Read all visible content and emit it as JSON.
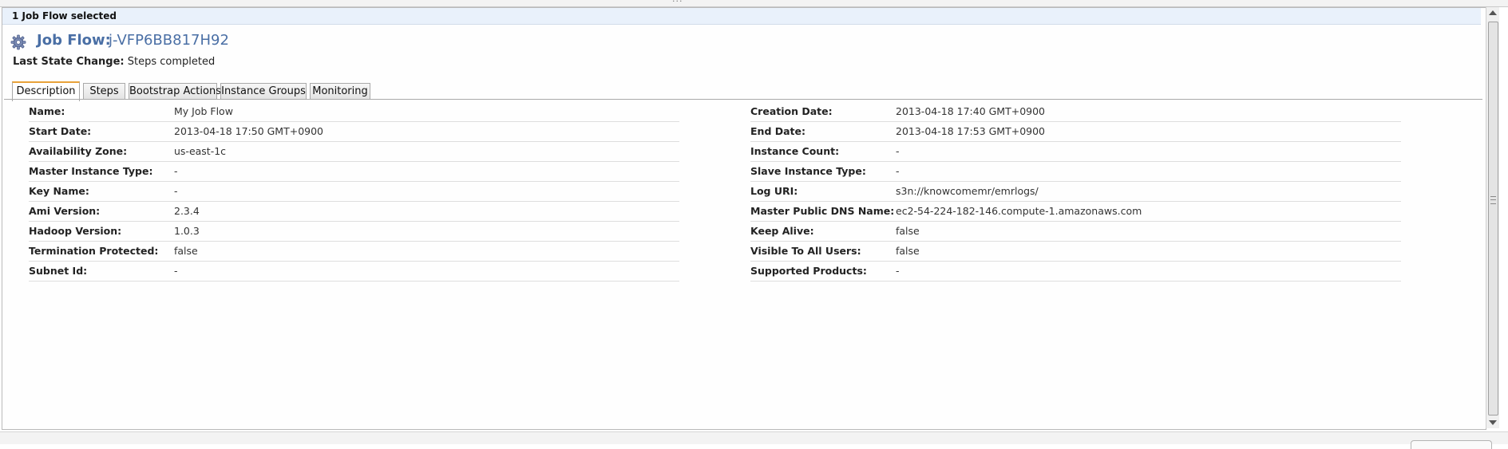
{
  "selection_bar": {
    "text": "1 Job Flow selected"
  },
  "header": {
    "icon": "gear-icon",
    "title_label": "Job Flow:",
    "title_id": "j-VFP6BB817H92",
    "state_label": "Last State Change:",
    "state_value": "Steps completed"
  },
  "tabs": [
    {
      "label": "Description",
      "active": true
    },
    {
      "label": "Steps",
      "active": false
    },
    {
      "label": "Bootstrap Actions",
      "active": false
    },
    {
      "label": "Instance Groups",
      "active": false
    },
    {
      "label": "Monitoring",
      "active": false
    }
  ],
  "details_left": [
    {
      "key": "Name:",
      "value": "My Job Flow"
    },
    {
      "key": "Start Date:",
      "value": "2013-04-18 17:50 GMT+0900"
    },
    {
      "key": "Availability Zone:",
      "value": "us-east-1c"
    },
    {
      "key": "Master Instance Type:",
      "value": "-"
    },
    {
      "key": "Key Name:",
      "value": "-"
    },
    {
      "key": "Ami Version:",
      "value": "2.3.4"
    },
    {
      "key": "Hadoop Version:",
      "value": "1.0.3"
    },
    {
      "key": "Termination Protected:",
      "value": "false"
    },
    {
      "key": "Subnet Id:",
      "value": "-"
    }
  ],
  "details_right": [
    {
      "key": "Creation Date:",
      "value": "2013-04-18 17:40 GMT+0900"
    },
    {
      "key": "End Date:",
      "value": "2013-04-18 17:53 GMT+0900"
    },
    {
      "key": "Instance Count:",
      "value": "-"
    },
    {
      "key": "Slave Instance Type:",
      "value": "-"
    },
    {
      "key": "Log URI:",
      "value": "s3n://knowcomemr/emrlogs/"
    },
    {
      "key": "Master Public DNS Name:",
      "value": "ec2-54-224-182-146.compute-1.amazonaws.com"
    },
    {
      "key": "Keep Alive:",
      "value": "false"
    },
    {
      "key": "Visible To All Users:",
      "value": "false"
    },
    {
      "key": "Supported Products:",
      "value": "-"
    }
  ],
  "colors": {
    "title": "#4a6fa5",
    "selection_bar": "#e9f1fb",
    "active_tab_accent": "#e8a23a"
  }
}
